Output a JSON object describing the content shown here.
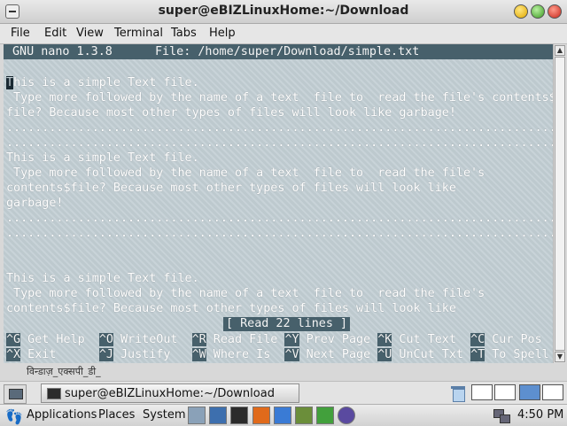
{
  "window": {
    "title": "super@eBIZLinuxHome:~/Download"
  },
  "menubar": [
    "File",
    "Edit",
    "View",
    "Terminal",
    "Tabs",
    "Help"
  ],
  "nano": {
    "version": "GNU nano 1.3.8",
    "file": "File: /home/super/Download/simple.txt",
    "cursor_char": "T",
    "lines": [
      "his is a simple Text file.",
      " Type more followed by the name of a text  file to  read the file's contents$",
      "file? Because most other types of files will look like garbage!",
      ".............................................................................",
      ".............................................................................",
      "This is a simple Text file.",
      " Type more followed by the name of a text  file to  read the file's",
      "contents$file? Because most other types of files will look like",
      "garbage!",
      ".............................................................................",
      ".............................................................................",
      "",
      "",
      "This is a simple Text file.",
      " Type more followed by the name of a text  file to  read the file's",
      "contents$file? Because most other types of files will look like"
    ],
    "status": "[ Read 22 lines ]",
    "shortcuts_row1": [
      {
        "key": "^G",
        "label": " Get Help  "
      },
      {
        "key": "^O",
        "label": " WriteOut  "
      },
      {
        "key": "^R",
        "label": " Read File "
      },
      {
        "key": "^Y",
        "label": " Prev Page "
      },
      {
        "key": "^K",
        "label": " Cut Text  "
      },
      {
        "key": "^C",
        "label": " Cur Pos"
      }
    ],
    "shortcuts_row2": [
      {
        "key": "^X",
        "label": " Exit      "
      },
      {
        "key": "^J",
        "label": " Justify   "
      },
      {
        "key": "^W",
        "label": " Where Is  "
      },
      {
        "key": "^V",
        "label": " Next Page "
      },
      {
        "key": "^U",
        "label": " UnCut Txt "
      },
      {
        "key": "^T",
        "label": " To Spell"
      }
    ]
  },
  "ime_indicator": "विन्डाज़_एक्सपी_डी_",
  "taskbar": {
    "task_label": "super@eBIZLinuxHome:~/Download"
  },
  "panel": {
    "applications": "Applications",
    "places": "Places",
    "system": "System",
    "clock": "4:50 PM"
  },
  "icons": {
    "window_menu": "window-menu-icon",
    "minimize": "minimize-icon",
    "maximize": "maximize-icon",
    "close": "close-icon",
    "terminal": "terminal-icon",
    "trash": "trash-icon",
    "network": "network-icon"
  },
  "colors": {
    "terminal_bg": "#c3cfd5",
    "nano_bar": "#47606b",
    "workspace_active": "#5d8fcf"
  }
}
